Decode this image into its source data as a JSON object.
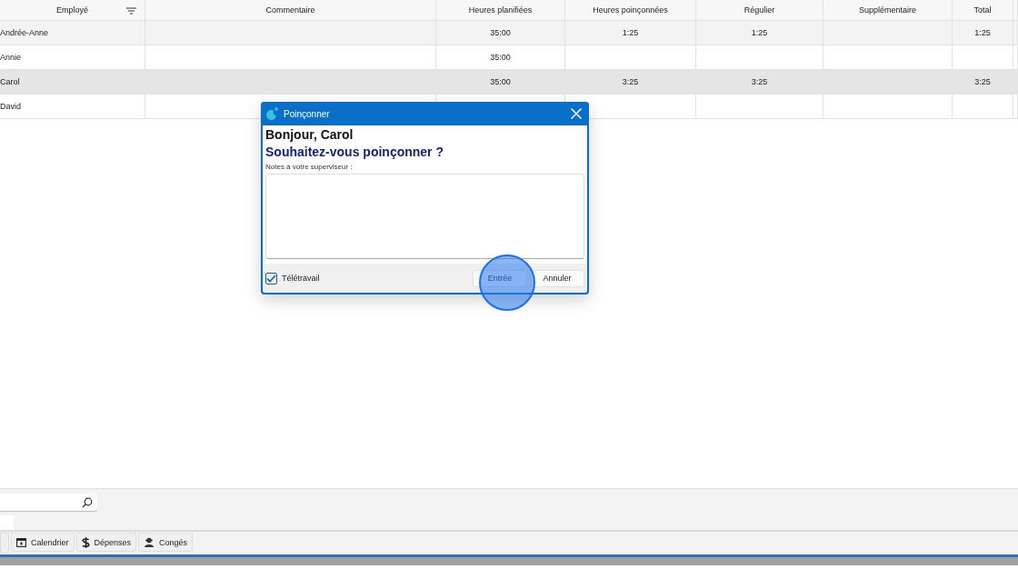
{
  "table": {
    "columns": [
      {
        "label": "Employé"
      },
      {
        "label": "Commentaire"
      },
      {
        "label": "Heures planifiées"
      },
      {
        "label": "Heures poinçonnées"
      },
      {
        "label": "Régulier"
      },
      {
        "label": "Supplémentaire"
      },
      {
        "label": "Total"
      }
    ],
    "rows": [
      {
        "selected": false,
        "cells": [
          "Andrée-Anne",
          "",
          "35:00",
          "1:25",
          "1:25",
          "",
          "1:25"
        ]
      },
      {
        "selected": false,
        "cells": [
          "Annie",
          "",
          "35:00",
          "",
          "",
          "",
          ""
        ]
      },
      {
        "selected": true,
        "cells": [
          "Carol",
          "",
          "35:00",
          "3:25",
          "3:25",
          "",
          "3:25"
        ]
      },
      {
        "selected": false,
        "cells": [
          "David",
          "",
          "",
          "",
          "",
          "",
          ""
        ]
      }
    ]
  },
  "dialog": {
    "title": "Poinçonner",
    "greeting": "Bonjour, Carol",
    "question": "Souhaitez-vous poinçonner ?",
    "notes_label": "Notes à votre superviseur :",
    "remote": {
      "label": "Télétravail",
      "checked": true
    },
    "buttons": [
      "Entrée",
      "Annuler"
    ]
  },
  "bottom_tabs": [
    {
      "label": "Calendrier"
    },
    {
      "label": "Dépenses"
    },
    {
      "label": "Congés"
    }
  ]
}
